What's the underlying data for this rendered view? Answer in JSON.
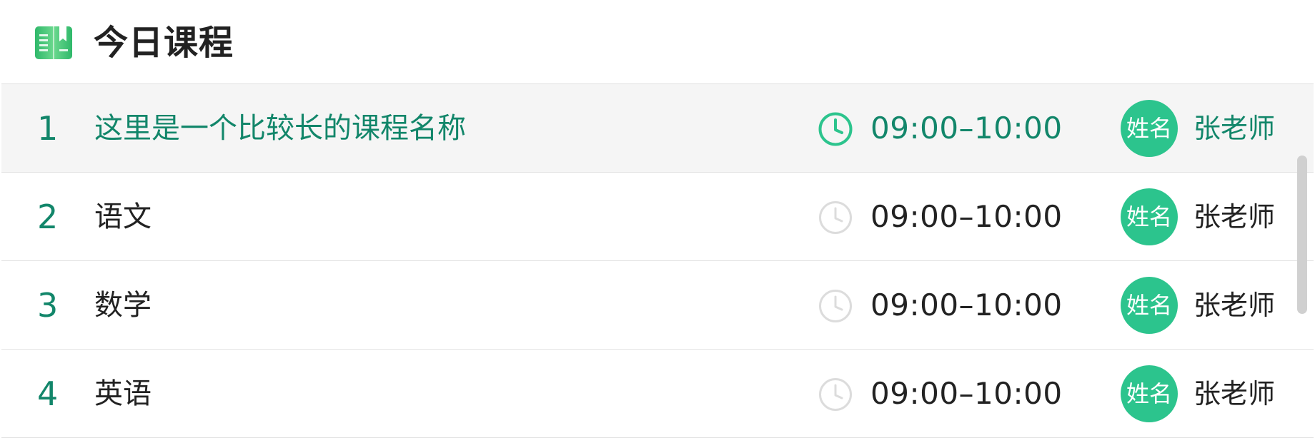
{
  "header": {
    "title": "今日课程",
    "icon": "book-icon"
  },
  "colors": {
    "accent": "#2cc48d",
    "accent_text": "#12866a",
    "active_row_bg": "#f5f5f5",
    "divider": "#e2e2e2",
    "clock_inactive": "#dcdcdc"
  },
  "courses": [
    {
      "index": "1",
      "name": "这里是一个比较长的课程名称",
      "time": "09:00–10:00",
      "avatar_label": "姓名",
      "teacher": "张老师",
      "active": true
    },
    {
      "index": "2",
      "name": "语文",
      "time": "09:00–10:00",
      "avatar_label": "姓名",
      "teacher": "张老师",
      "active": false
    },
    {
      "index": "3",
      "name": "数学",
      "time": "09:00–10:00",
      "avatar_label": "姓名",
      "teacher": "张老师",
      "active": false
    },
    {
      "index": "4",
      "name": "英语",
      "time": "09:00–10:00",
      "avatar_label": "姓名",
      "teacher": "张老师",
      "active": false
    }
  ]
}
